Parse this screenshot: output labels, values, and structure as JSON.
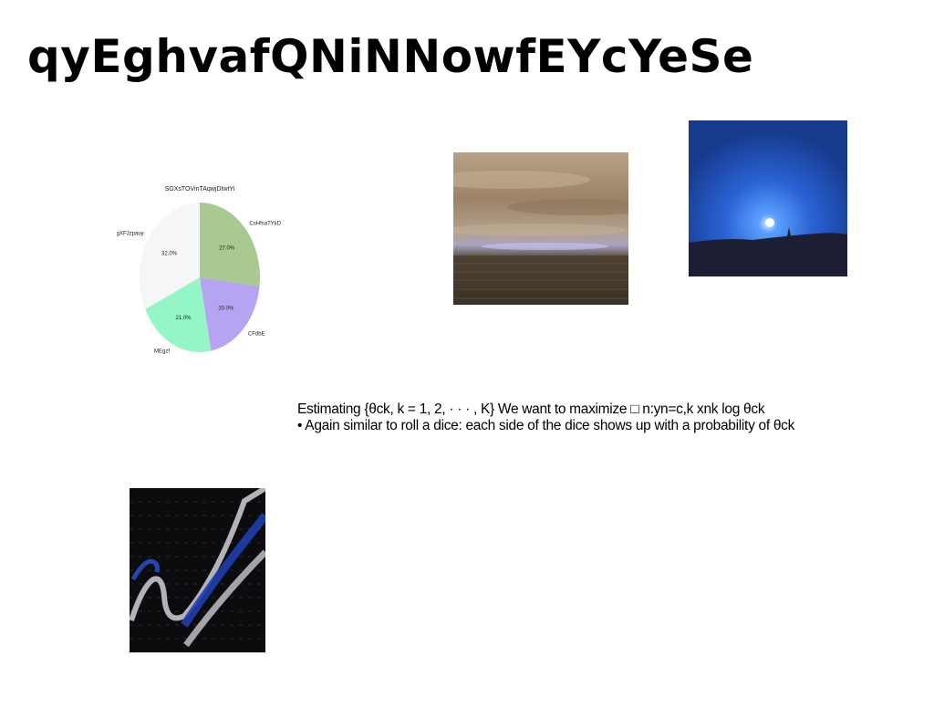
{
  "slide": {
    "title": "qyEghvafQNiNNowfEYcYeSe"
  },
  "body_text": {
    "line1": "Estimating {θck, k = 1, 2, · · · , K} We want to maximize □ n:yn=c,k xnk log θck",
    "line2": "• Again similar to roll a dice: each side of the dice shows up with a probability of θck"
  },
  "images": {
    "desert": "desert-horizon-photo",
    "moon": "blue-night-moon-photo",
    "abstract": "abstract-dark-waves-image"
  },
  "chart_data": {
    "type": "pie",
    "title": "SGXsTOVinTAqwjDIwtYi",
    "slices": [
      {
        "label": "CsHfsaTYkD",
        "value": 27.0,
        "pct_label": "27.0%",
        "color": "#a8c98f"
      },
      {
        "label": "CFdbE",
        "value": 20.0,
        "pct_label": "20.0%",
        "color": "#b6a4f2"
      },
      {
        "label": "MEgzf",
        "value": 21.0,
        "pct_label": "21.0%",
        "color": "#94f5c6"
      },
      {
        "label": "gXFJzpauy",
        "value": 32.0,
        "pct_label": "32.0%",
        "color": "#f4f6f7"
      }
    ],
    "start_angle": "top",
    "direction": "clockwise"
  }
}
